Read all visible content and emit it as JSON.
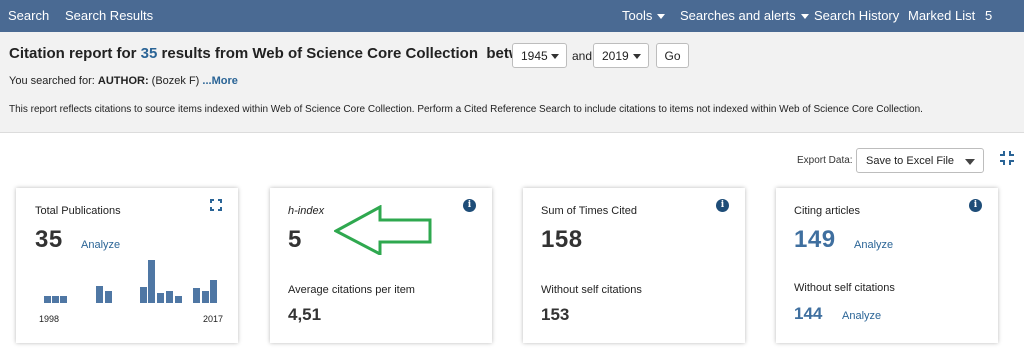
{
  "nav": {
    "search": "Search",
    "search_results": "Search Results",
    "tools": "Tools",
    "searches_alerts": "Searches and alerts",
    "search_history": "Search History",
    "marked_list": "Marked List",
    "marked_count": "5"
  },
  "report": {
    "title_prefix": "Citation report for",
    "count": "35",
    "title_suffix": "results from Web of Science Core Collection",
    "between": "between",
    "year_from": "1945",
    "and": "and",
    "year_to": "2019",
    "go": "Go",
    "searched_label": "You searched for:",
    "searched_query": "AUTHOR:",
    "searched_value": "(Bozek F)",
    "more": "...More",
    "note": "This report reflects citations to source items indexed within Web of Science Core Collection. Perform a Cited Reference Search to include citations to items not indexed within Web of Science Core Collection."
  },
  "export": {
    "label": "Export Data:",
    "value": "Save to Excel File"
  },
  "cards": {
    "publications": {
      "label": "Total Publications",
      "value": "35",
      "analyze": "Analyze",
      "year_start": "1998",
      "year_end": "2017",
      "bar_heights": [
        0.17,
        0.17,
        0.17,
        0.4,
        0.28,
        0.38,
        1.0,
        0.23,
        0.28,
        0.17,
        0.35,
        0.28,
        0.53
      ]
    },
    "hindex": {
      "label": "h-index",
      "value": "5",
      "avg_label": "Average citations per item",
      "avg_value": "4,51"
    },
    "times_cited": {
      "label": "Sum of Times Cited",
      "value": "158",
      "without_label": "Without self citations",
      "without_value": "153"
    },
    "citing": {
      "label": "Citing articles",
      "value": "149",
      "analyze": "Analyze",
      "without_label": "Without self citations",
      "without_value": "144",
      "analyze2": "Analyze"
    }
  },
  "colors": {
    "nav_bg": "#4a6a93",
    "link": "#2a6496",
    "bar": "#4f77a4",
    "annotation_arrow": "#2fa84f"
  }
}
